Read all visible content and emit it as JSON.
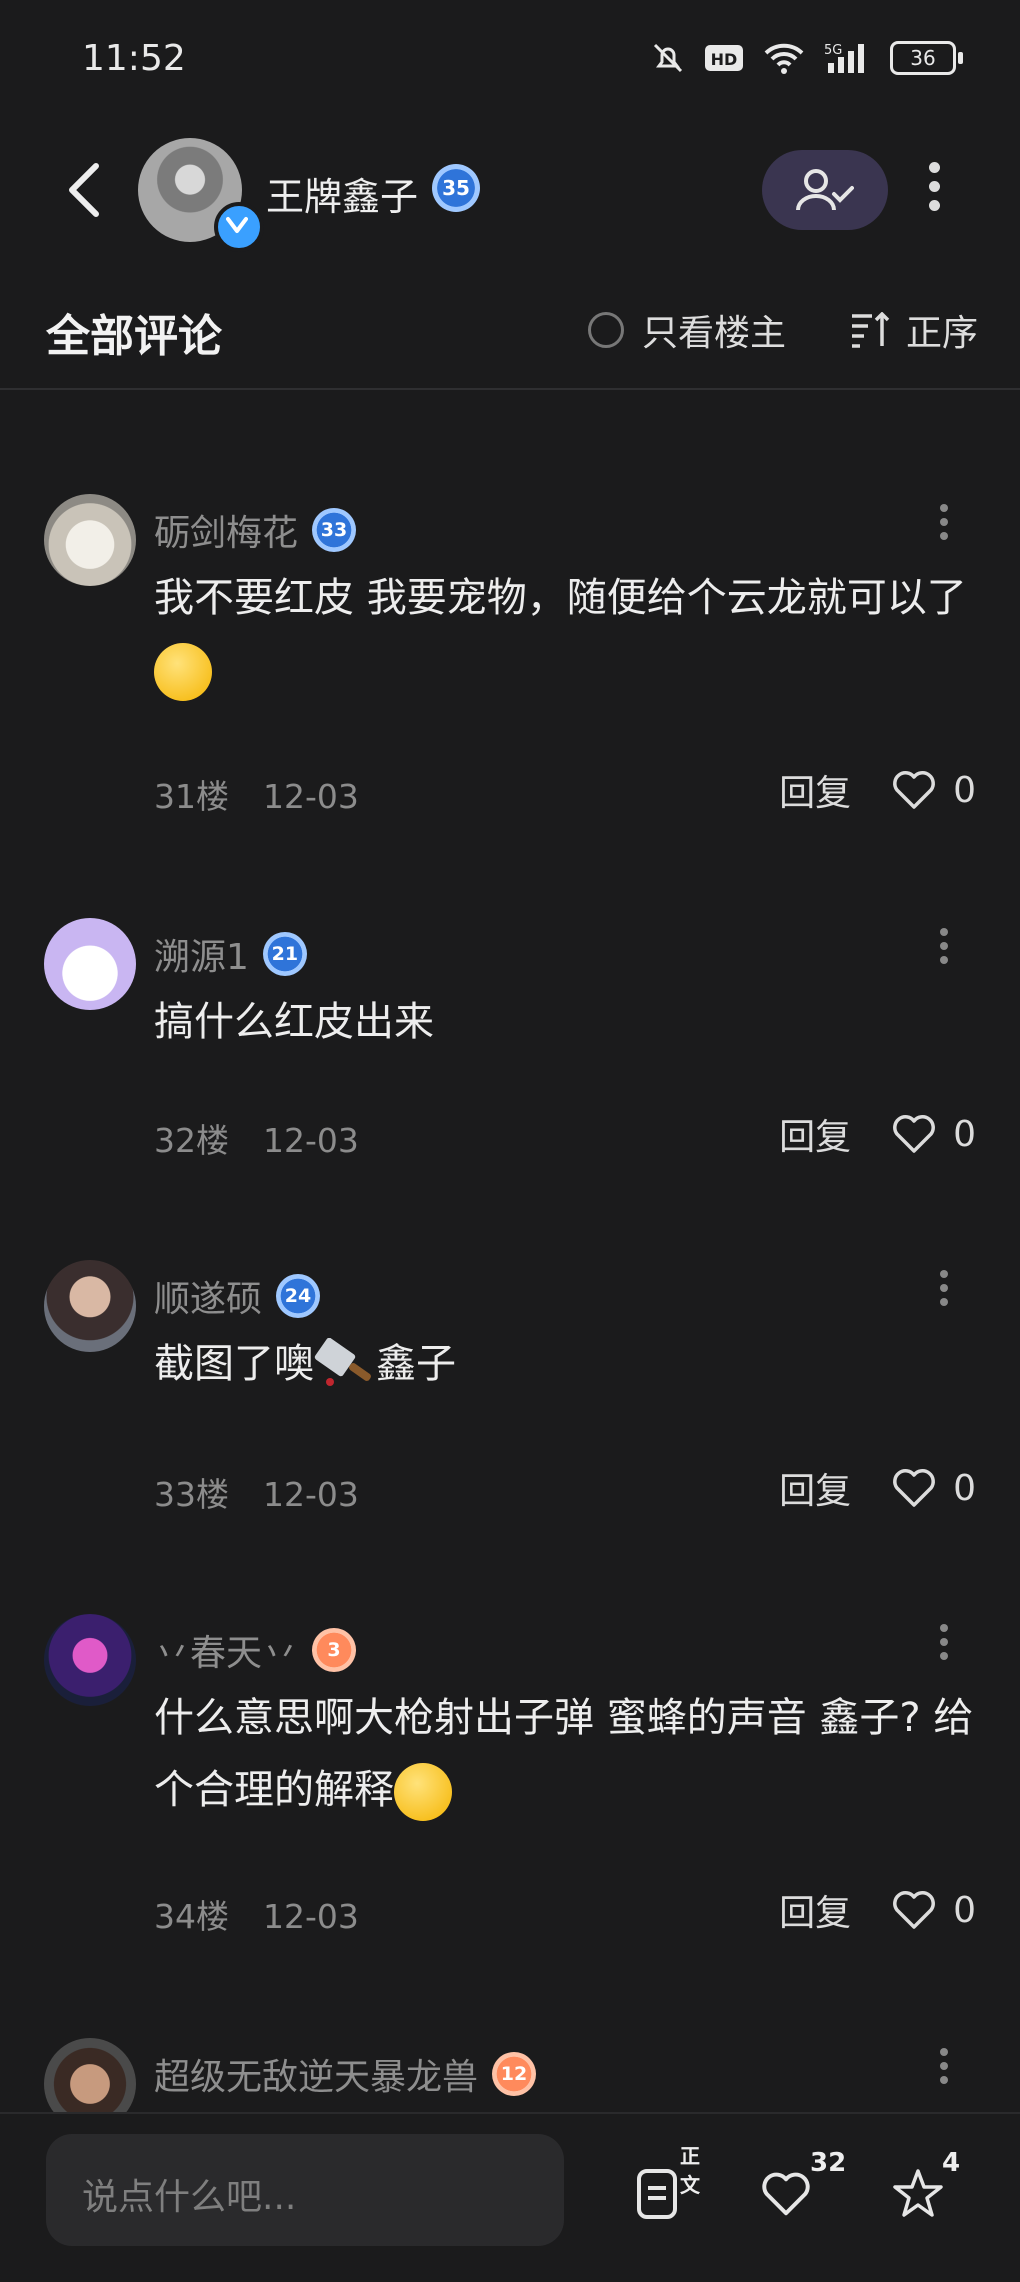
{
  "status_bar": {
    "time": "11:52",
    "battery": "36"
  },
  "header": {
    "username": "王牌鑫子",
    "level": "35"
  },
  "filter": {
    "title": "全部评论",
    "only_op": "只看楼主",
    "sort": "正序"
  },
  "comments": [
    {
      "name": "砺剑梅花",
      "level": "33",
      "text": "我不要红皮   我要宠物，随便给个云龙就可以了",
      "floor": "31楼",
      "date": "12-03",
      "reply": "回复",
      "likes": "0"
    },
    {
      "name": "溯源1",
      "level": "21",
      "text": "搞什么红皮出来",
      "floor": "32楼",
      "date": "12-03",
      "reply": "回复",
      "likes": "0"
    },
    {
      "name": "顺遂硕",
      "level": "24",
      "text_before": "截图了噢",
      "text_after": "鑫子",
      "floor": "33楼",
      "date": "12-03",
      "reply": "回复",
      "likes": "0"
    },
    {
      "name": "丷春天丷",
      "level": "3",
      "text": "什么意思啊大枪射出子弹   蜜蜂的声音   鑫子?      给个合理的解释",
      "floor": "34楼",
      "date": "12-03",
      "reply": "回复",
      "likes": "0"
    },
    {
      "name": "超级无敌逆天暴龙兽",
      "level": "12"
    }
  ],
  "bottom_bar": {
    "placeholder": "说点什么吧...",
    "article_label": "正文",
    "like_count": "32",
    "fav_count": "4"
  },
  "colors": {
    "background": "#1b1b1c",
    "level_blue": "#2f74d9",
    "level_orange": "#ff8a5c",
    "verified": "#3aa0ff"
  }
}
